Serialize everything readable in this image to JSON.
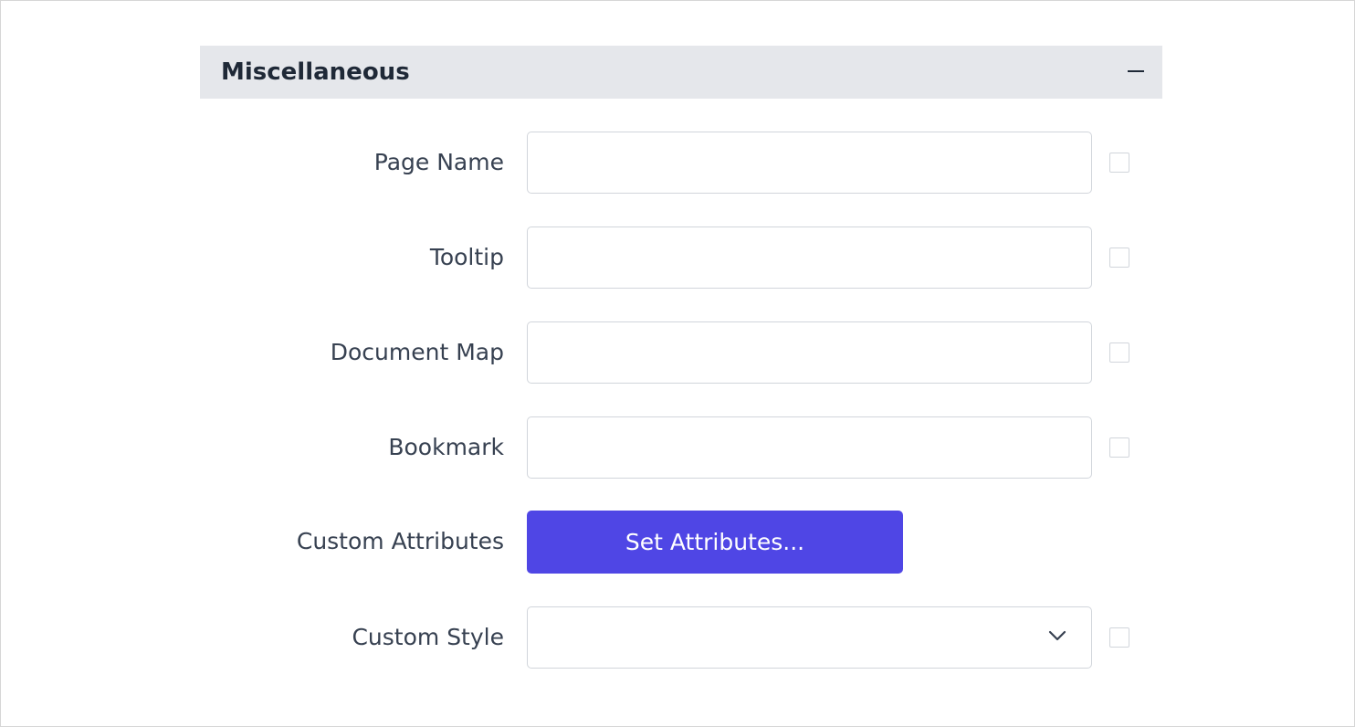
{
  "panel": {
    "title": "Miscellaneous"
  },
  "fields": {
    "page_name": {
      "label": "Page Name",
      "value": ""
    },
    "tooltip": {
      "label": "Tooltip",
      "value": ""
    },
    "document_map": {
      "label": "Document Map",
      "value": ""
    },
    "bookmark": {
      "label": "Bookmark",
      "value": ""
    },
    "custom_attributes": {
      "label": "Custom Attributes",
      "button_label": "Set Attributes..."
    },
    "custom_style": {
      "label": "Custom Style",
      "selected": ""
    }
  },
  "icons": {
    "collapse": "minus-icon",
    "dropdown": "chevron-down-icon"
  },
  "colors": {
    "header_bg": "#e5e7eb",
    "accent": "#4f46e5",
    "border": "#d1d5db"
  }
}
